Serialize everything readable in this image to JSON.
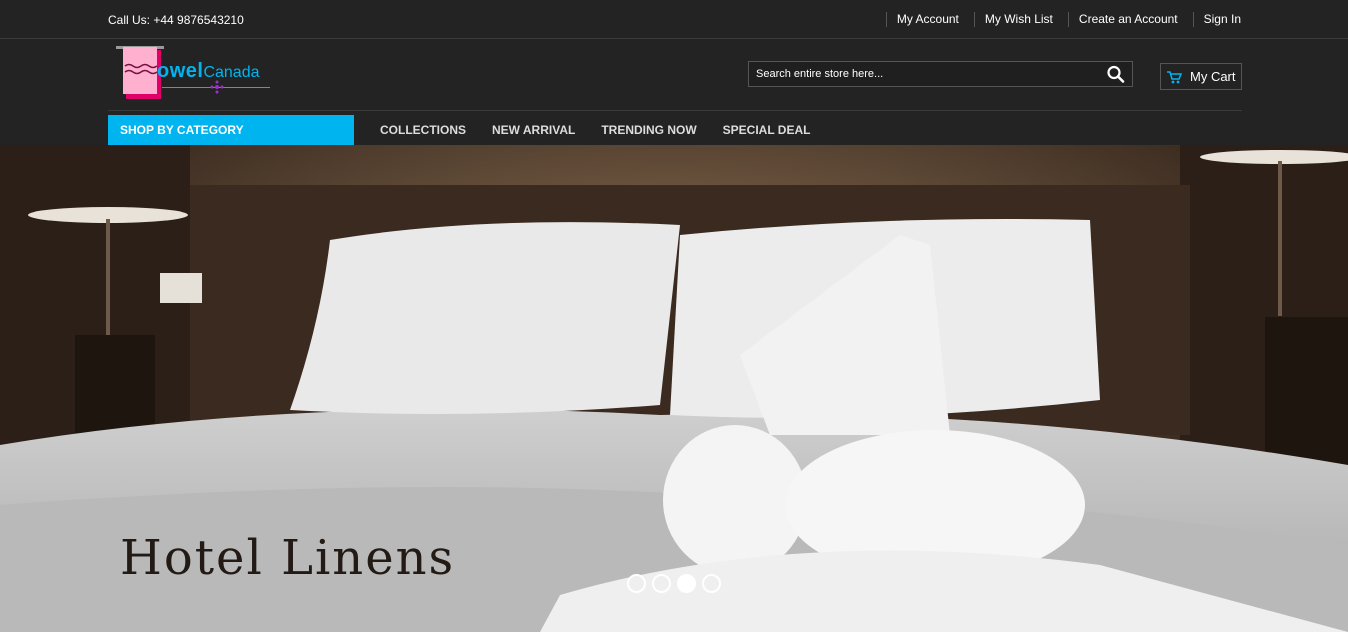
{
  "topbar": {
    "call": "Call Us: +44 9876543210",
    "links": [
      "My Account",
      "My Wish List",
      "Create an Account",
      "Sign In"
    ]
  },
  "logo": {
    "part1": "owel",
    "part2": "Canada"
  },
  "search": {
    "placeholder": "Search entire store here...",
    "icon": "search-icon"
  },
  "cart": {
    "label": "My Cart",
    "icon": "cart-icon"
  },
  "nav": {
    "category": "SHOP BY CATEGORY",
    "links": [
      "COLLECTIONS",
      "NEW ARRIVAL",
      "TRENDING NOW",
      "SPECIAL DEAL"
    ]
  },
  "hero": {
    "title": "Hotel Linens"
  },
  "slider": {
    "count": 4,
    "active": 3
  },
  "colors": {
    "accent": "#00b4f0",
    "background": "#232323",
    "logo_pink": "#ff8fc0"
  }
}
